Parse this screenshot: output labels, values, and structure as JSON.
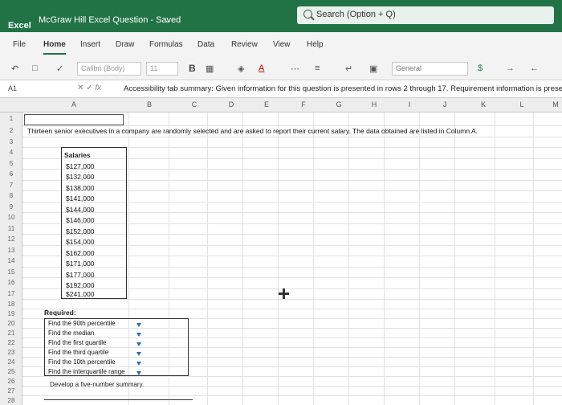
{
  "app": {
    "name": "Excel",
    "doc_title": "McGraw Hill Excel Question - Saved",
    "search_placeholder": "Search (Option + Q)"
  },
  "tabs": [
    "File",
    "Home",
    "Insert",
    "Draw",
    "Formulas",
    "Data",
    "Review",
    "View",
    "Help"
  ],
  "active_tab": "Home",
  "toolbar": {
    "font": "Calibri (Body)",
    "size": "11",
    "bold": "B",
    "number_format": "General",
    "currency": "$"
  },
  "formula_bar": {
    "cell_ref": "A1",
    "fx": "fx",
    "content": "Accessibility tab summary: Given information for this question is presented in rows 2 through 17. Requirement information is prese"
  },
  "columns": [
    "A",
    "B",
    "C",
    "D",
    "E",
    "F",
    "G",
    "H",
    "I",
    "J",
    "K",
    "L",
    "M"
  ],
  "rows": [
    "1",
    "2",
    "3",
    "4",
    "5",
    "6",
    "7",
    "8",
    "9",
    "10",
    "11",
    "12",
    "13",
    "14",
    "15",
    "16",
    "17",
    "18",
    "19",
    "20",
    "21",
    "22",
    "23",
    "24",
    "25",
    "26",
    "27",
    "28"
  ],
  "sheet": {
    "intro": "Thirteen senior executives in a company are randomly selected and are asked to report their current salary. The data obtained are listed in Column A.",
    "salary_header": "Salaries",
    "salaries": [
      "$127,000",
      "$132,000",
      "$138,000",
      "$141,000",
      "$144,000",
      "$146,000",
      "$152,000",
      "$154,000",
      "$162,000",
      "$171,000",
      "$177,000",
      "$192,000",
      "$241,000"
    ],
    "required_label": "Required:",
    "requirements": [
      "Find the 90th percentile",
      "Find the median",
      "Find the first quartile",
      "Find the third quartile",
      "Find the 10th percentile",
      "Find the interquartile range"
    ],
    "develop": "Develop a five-number summary."
  }
}
